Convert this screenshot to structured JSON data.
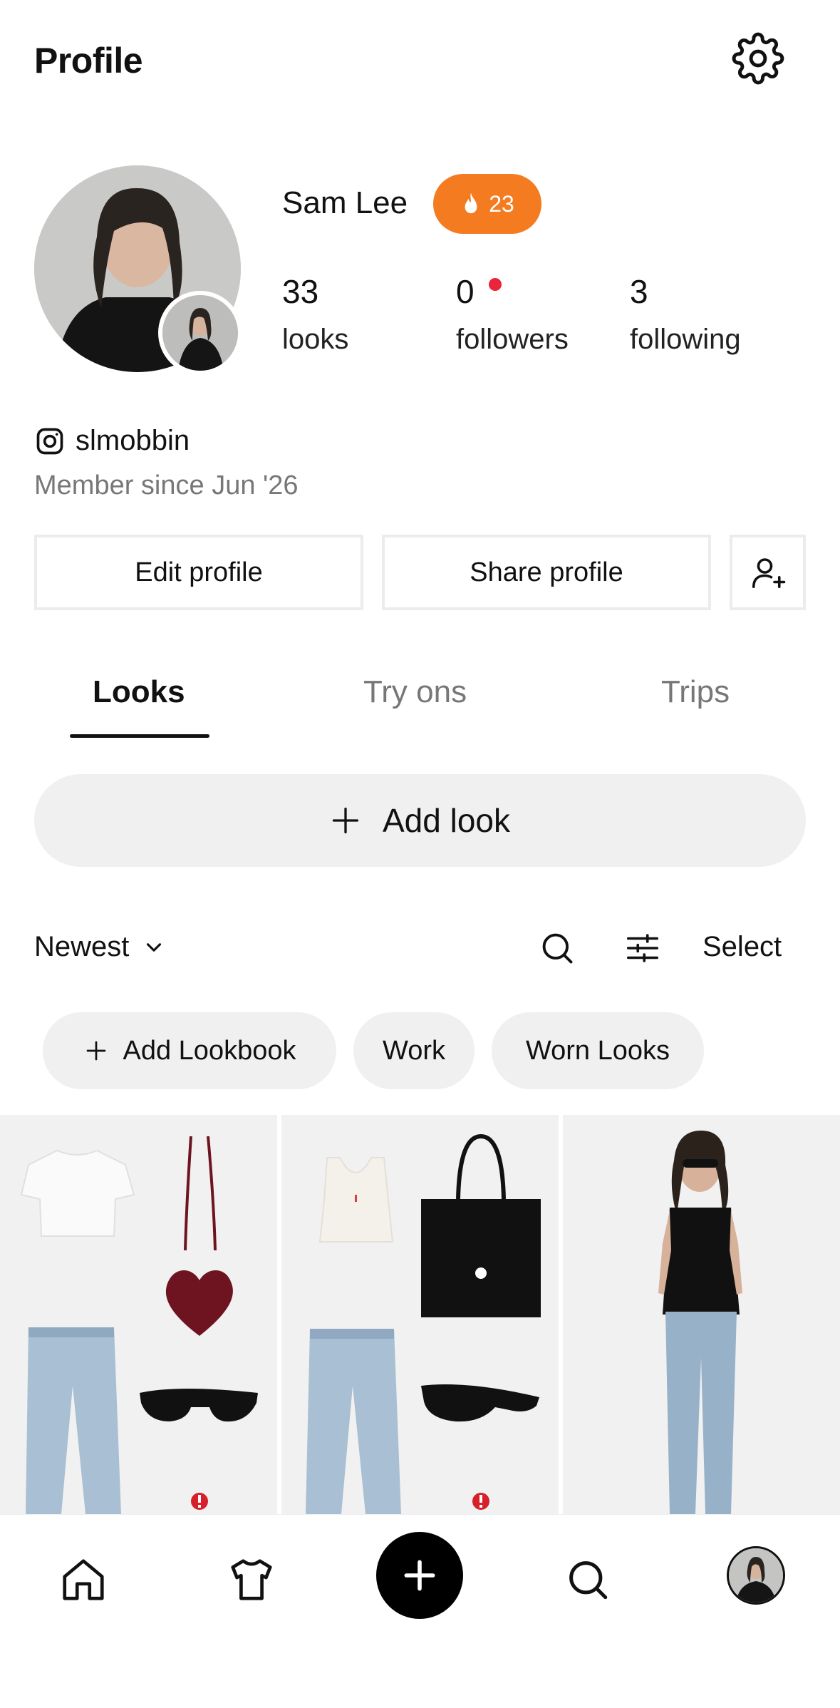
{
  "header": {
    "title": "Profile"
  },
  "profile": {
    "name": "Sam Lee",
    "streak": "23",
    "stats": [
      {
        "value": "33",
        "label": "looks"
      },
      {
        "value": "0",
        "label": "followers"
      },
      {
        "value": "3",
        "label": "following"
      }
    ],
    "instagram_handle": "slmobbin",
    "member_since": "Member since Jun '26"
  },
  "actions": {
    "edit": "Edit profile",
    "share": "Share profile"
  },
  "tabs": [
    {
      "label": "Looks"
    },
    {
      "label": "Try ons"
    },
    {
      "label": "Trips"
    }
  ],
  "add_look": "Add look",
  "toolbar": {
    "sort": "Newest",
    "select": "Select"
  },
  "chips": [
    {
      "label": "Add Lookbook"
    },
    {
      "label": "Work"
    },
    {
      "label": "Worn Looks"
    }
  ],
  "colors": {
    "streak": "#f47b20",
    "notification_dot": "#e8253a",
    "chip_bg": "#f0f0f0"
  },
  "icons": {
    "settings": "gear-icon",
    "streak": "flame-icon",
    "instagram": "instagram-icon",
    "add_friend": "add-user-icon",
    "search": "search-icon",
    "filter": "sliders-icon",
    "nav": [
      "home-icon",
      "shirt-icon",
      "plus-icon",
      "search-icon",
      "avatar"
    ]
  }
}
